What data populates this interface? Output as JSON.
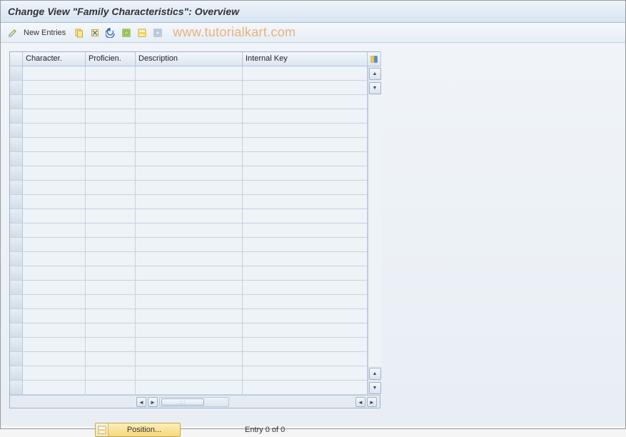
{
  "header": {
    "title": "Change View \"Family Characteristics\": Overview"
  },
  "toolbar": {
    "pencil": "pencil",
    "new_entries": "New Entries",
    "copy": "copy",
    "delete": "delete",
    "undo": "undo",
    "select_all": "select-all",
    "select_block": "select-block",
    "deselect": "deselect"
  },
  "watermark": "www.tutorialkart.com",
  "table": {
    "columns": [
      "Character.",
      "Proficien.",
      "Description",
      "Internal Key"
    ],
    "rows": 23
  },
  "footer": {
    "position_label": "Position...",
    "entry_text": "Entry 0 of 0"
  }
}
